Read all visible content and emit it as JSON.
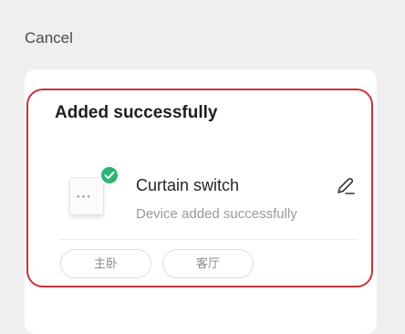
{
  "header": {
    "cancel_label": "Cancel"
  },
  "card": {
    "title": "Added successfully",
    "device": {
      "name": "Curtain switch",
      "status": "Device added successfully",
      "icon": "curtain-switch-icon",
      "badge_icon": "check-icon",
      "edit_icon": "pencil-icon"
    },
    "rooms": [
      "主卧",
      "客厅"
    ]
  },
  "colors": {
    "background": "#efefef",
    "card": "#ffffff",
    "highlight_border": "#c8323a",
    "success_badge": "#2bb673",
    "muted_text": "#9a9a9a"
  }
}
